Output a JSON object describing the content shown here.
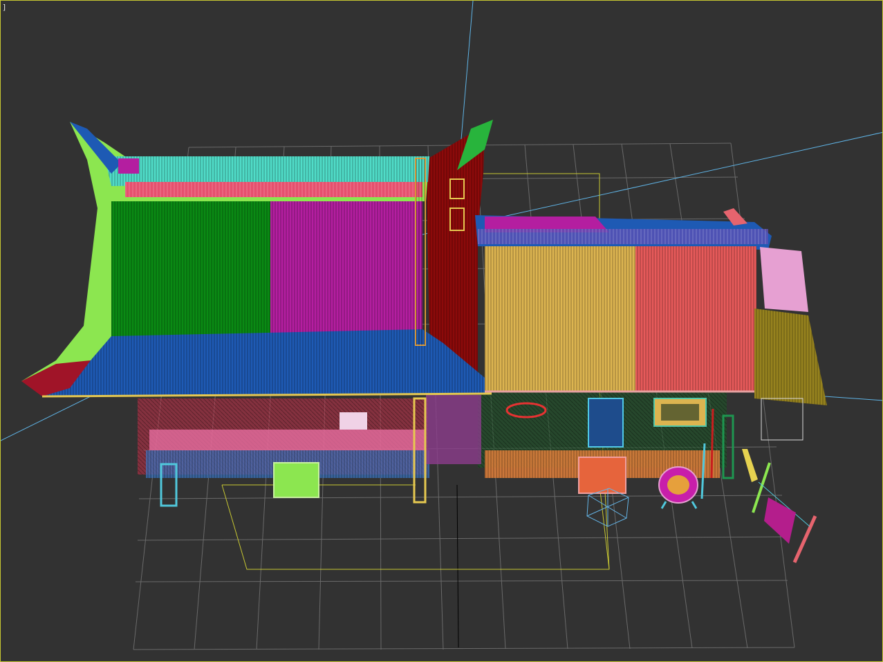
{
  "viewport": {
    "label": "]",
    "background": "#323232",
    "border_color": "#c8c832",
    "grid_color": "#6e6e6e",
    "axis_color": "#5fb4e6",
    "selection_color": "#c8c832"
  },
  "scene": {
    "objects": [
      {
        "name": "left-roof-green-panel",
        "color": "#0a8a14"
      },
      {
        "name": "left-roof-magenta-panel",
        "color": "#b41ea0"
      },
      {
        "name": "left-roof-blue-eave",
        "color": "#1e5ab4"
      },
      {
        "name": "left-roof-ridge-cyan",
        "color": "#50dcc8"
      },
      {
        "name": "left-roof-lime-side",
        "color": "#8ce650"
      },
      {
        "name": "gable-wall-darkred",
        "color": "#8c0a0a"
      },
      {
        "name": "right-roof-yellow-panel",
        "color": "#dcb450"
      },
      {
        "name": "right-roof-salmon-panel",
        "color": "#e65a5a"
      },
      {
        "name": "right-roof-ridge",
        "color": "#1e5ab4"
      },
      {
        "name": "side-awning-pink",
        "color": "#e6a0d2"
      },
      {
        "name": "side-awning-olive",
        "color": "#96821e"
      },
      {
        "name": "lantern-ring",
        "color": "#c81eaa"
      },
      {
        "name": "hanging-banner",
        "color": "#b41e8c"
      }
    ]
  }
}
